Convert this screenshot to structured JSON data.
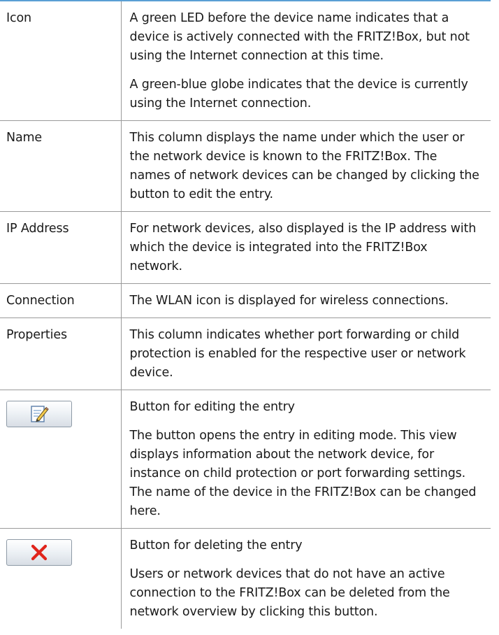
{
  "rows": [
    {
      "term": "Icon",
      "p1": "A green LED before the device name indicates that a device is actively connected with the FRITZ!Box, but not using the Internet connection at this time.",
      "p2": "A green-blue globe indicates that the device is cur­rently using the Internet connection."
    },
    {
      "term": "Name",
      "p1": "This column displays the name under which the user or the network device is known to the FRITZ!Box. The names of network devices can be changed by clicking the button to edit the entry."
    },
    {
      "term": "IP Address",
      "p1": "For network devices, also displayed is the IP ad­dress with which the device is integrated into the FRITZ!Box network."
    },
    {
      "term": "Connection",
      "p1": "The WLAN icon is displayed for wireless connec­tions."
    },
    {
      "term": "Properties",
      "p1": "This column indicates whether port forwarding or child protection is enabled for the respective user or network device."
    },
    {
      "icon": "edit-icon",
      "p1": "Button for editing the entry",
      "p2": "The button opens the entry in editing mode. This view displays information about the network de­vice, for instance on child protection or port for­warding settings. The name of the device in the FRITZ!Box can be changed here."
    },
    {
      "icon": "delete-icon",
      "p1": "Button for deleting the entry",
      "p2": "Users or network devices that do not have an ac­tive connection to the FRITZ!Box can be deleted from the network overview by clicking this button."
    }
  ],
  "colors": {
    "top_rule": "#5a9fd4",
    "grid": "#9a9a9a",
    "delete_red": "#e0241b",
    "edit_blue": "#3f7fc4"
  }
}
